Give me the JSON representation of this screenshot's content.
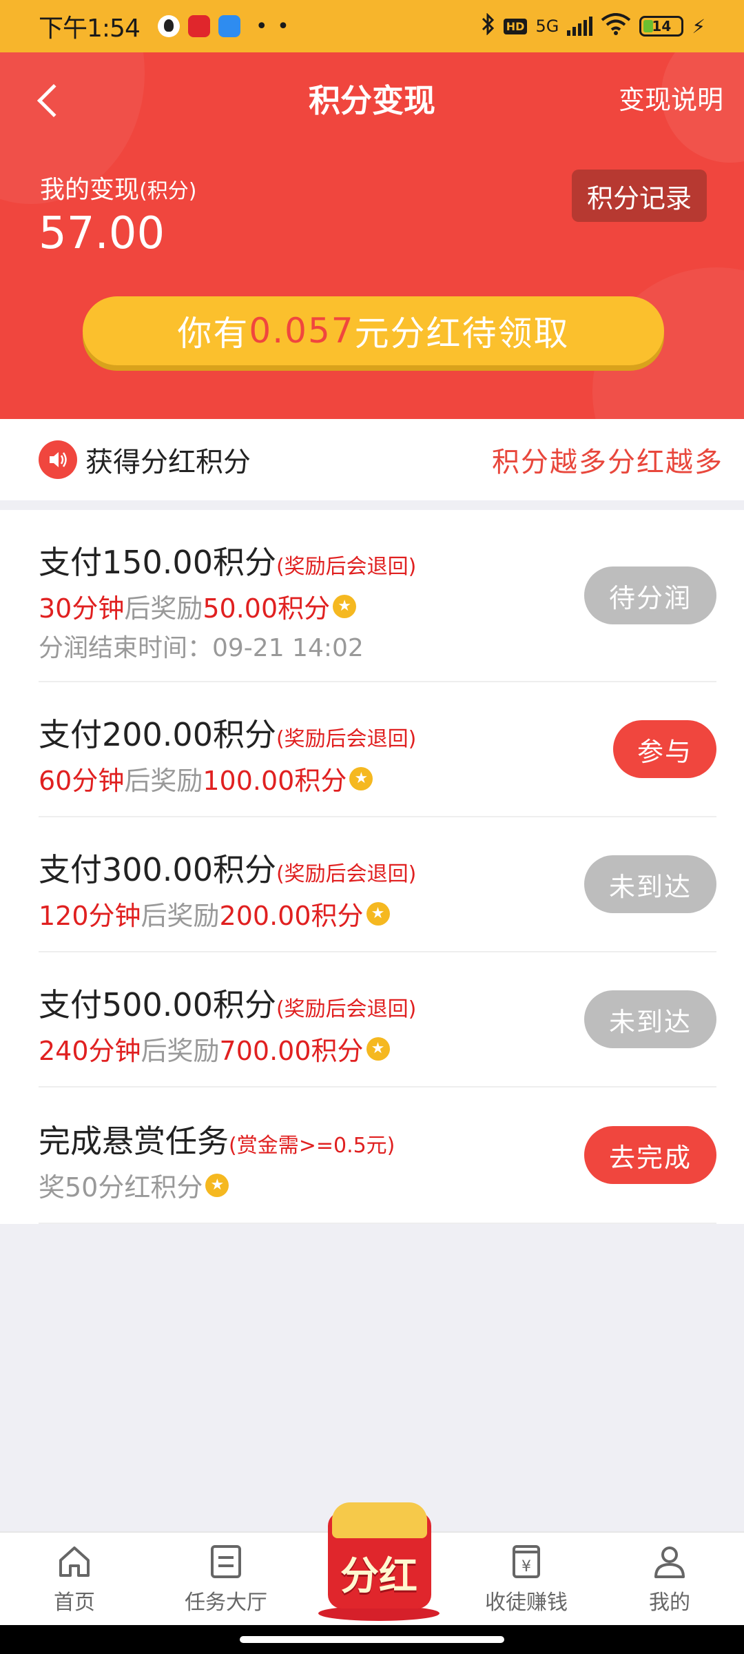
{
  "status_bar": {
    "time": "下午1:54",
    "network": "5G",
    "hd": "HD",
    "battery": "14"
  },
  "header": {
    "title": "积分变现",
    "explain_link": "变现说明",
    "mine_label": "我的变现",
    "mine_unit": "(积分)",
    "mine_value": "57.00",
    "record_button": "积分记录",
    "bonus_prefix": "你有",
    "bonus_amount": "0.057",
    "bonus_suffix": "元分红待领取"
  },
  "notice": {
    "title": "获得分红积分",
    "slogan": "积分越多分红越多"
  },
  "tasks": [
    {
      "title": "支付150.00积分",
      "note": "(奖励后会退回)",
      "time": "30分钟",
      "mid": "后奖励",
      "reward": "50.00积分",
      "extra": "分润结束时间：09-21 14:02",
      "button": "待分润"
    },
    {
      "title": "支付200.00积分",
      "note": "(奖励后会退回)",
      "time": "60分钟",
      "mid": "后奖励",
      "reward": "100.00积分",
      "button": "参与"
    },
    {
      "title": "支付300.00积分",
      "note": "(奖励后会退回)",
      "time": "120分钟",
      "mid": "后奖励",
      "reward": "200.00积分",
      "button": "未到达"
    },
    {
      "title": "支付500.00积分",
      "note": "(奖励后会退回)",
      "time": "240分钟",
      "mid": "后奖励",
      "reward": "700.00积分",
      "button": "未到达"
    },
    {
      "title": "完成悬赏任务",
      "note": "(赏金需>=0.5元)",
      "desc": "奖50分红积分",
      "button": "去完成"
    }
  ],
  "tabbar": {
    "home": "首页",
    "task_hall": "任务大厅",
    "center": "分红",
    "earn": "收徒赚钱",
    "mine": "我的"
  },
  "colors": {
    "primary_red": "#f0463e",
    "status_yellow": "#f7b52c",
    "bonus_yellow": "#fbc02d",
    "text_red": "#e02020",
    "disabled_gray": "#bdbdbd"
  }
}
